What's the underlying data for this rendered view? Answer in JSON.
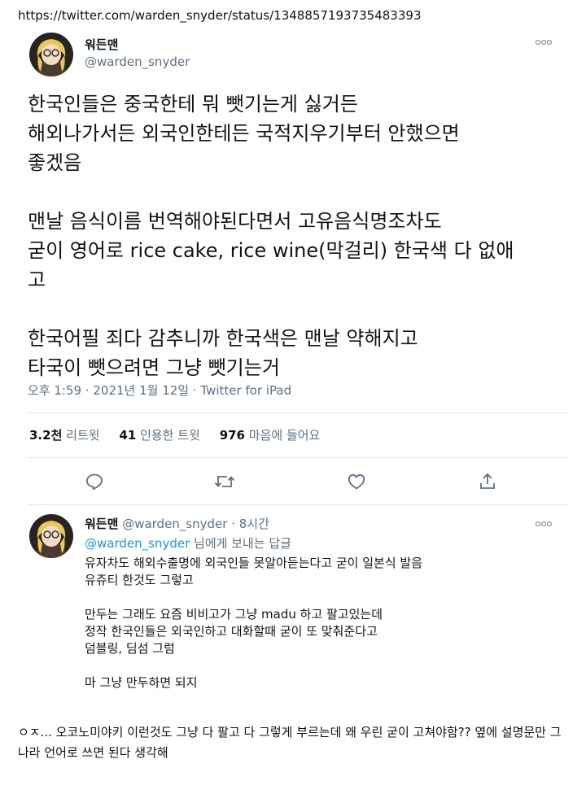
{
  "url_bar": {
    "text": "https://twitter.com/warden_snyder/status/1348857193735483393"
  },
  "tweet": {
    "display_name": "워든맨",
    "handle": "@warden_snyder",
    "more_icon": "more-dots-icon",
    "paragraphs": [
      "한국인들은 중국한테 뭐 뺏기는게 싫거든\n해외나가서든 외국인한테든 국적지우기부터 안했으면\n좋겠음",
      "맨날 음식이름 번역해야된다면서 고유음식명조차도\n굳이 영어로 rice cake, rice wine(막걸리) 한국색 다 없애\n고",
      "한국어필 죄다 감추니까 한국색은 맨날 약해지고\n타국이 뺏으려면 그냥 뺏기는거"
    ],
    "timestamp": "오후 1:59 · 2021년 1월 12일 · Twitter for iPad"
  },
  "stats": {
    "retweets_count": "3.2천",
    "retweets_label": "리트윗",
    "quotes_count": "41",
    "quotes_label": "인용한 트윗",
    "likes_count": "976",
    "likes_label": "마음에 들어요"
  },
  "actions": {
    "reply_icon": "reply-icon",
    "retweet_icon": "retweet-icon",
    "like_icon": "heart-icon",
    "share_icon": "share-icon"
  },
  "reply": {
    "display_name": "워든맨",
    "handle_time": "@warden_snyder · 8시간",
    "reply_to_handle": "@warden_snyder",
    "reply_to_suffix": " 님에게 보내는 답글",
    "paragraphs": [
      "유자차도 해외수출명에 외국인들 못알아듣는다고 굳이 일본식 발음\n유쥬티 한것도 그렇고",
      "만두는 그래도 요즘 비비고가 그냥 madu 하고 팔고있는데\n정작 한국인들은 외국인하고 대화할때 굳이 또 맞춰준다고\n덤블링, 딤섬  그럼",
      "마 그냥 만두하면 되지"
    ]
  },
  "comment": {
    "text": "ㅇㅈ... 오코노미야키 이런것도 그냥 다 팔고 다 그렇게 부르는데 왜 우린 굳이 고쳐야함?? 옆에 설명문만 그나라 언어로 쓰면 된다 생각해"
  },
  "colors": {
    "link_blue": "#1b95e0",
    "muted_text": "#5b7083",
    "divider": "#e1e8ed"
  }
}
